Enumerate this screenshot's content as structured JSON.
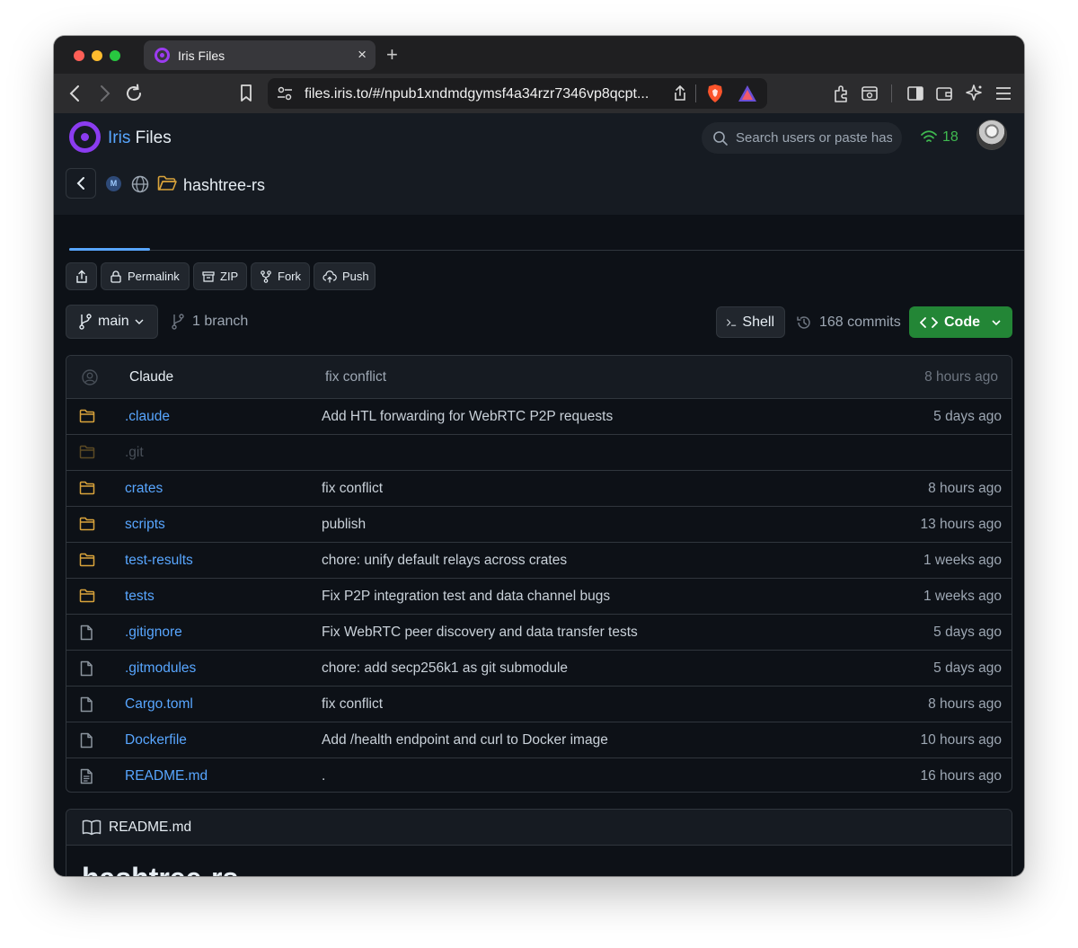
{
  "browser": {
    "tab_title": "Iris Files",
    "tab_close": "×",
    "new_tab": "+",
    "url": "files.iris.to/#/npub1xndmdgymsf4a34rzr7346vp8qcpt..."
  },
  "app": {
    "brand_primary": "Iris",
    "brand_secondary": "Files",
    "search_placeholder": "Search users or paste hash",
    "peer_count": "18",
    "repo_name": "hashtree-rs",
    "colors": {
      "accent": "#58a6ff",
      "brand": "#8b3cf0",
      "folder": "#d9a33b",
      "online": "#3fb950",
      "code_button": "#238636"
    }
  },
  "actions": [
    {
      "label": "",
      "icon": "share-icon"
    },
    {
      "label": "Permalink",
      "icon": "lock-icon"
    },
    {
      "label": "ZIP",
      "icon": "archive-icon"
    },
    {
      "label": "Fork",
      "icon": "fork-icon"
    },
    {
      "label": "Push",
      "icon": "cloud-upload-icon"
    }
  ],
  "repo_bar": {
    "branch": "main",
    "branch_count": "1 branch",
    "shell": "Shell",
    "commits": "168 commits",
    "code": "Code"
  },
  "last_commit": {
    "author": "Claude",
    "message": "fix conflict",
    "time": "8 hours ago"
  },
  "files": [
    {
      "type": "folder",
      "name": ".claude",
      "message": "Add HTL forwarding for WebRTC P2P requests",
      "time": "5 days ago",
      "dim": false
    },
    {
      "type": "folder",
      "name": ".git",
      "message": "",
      "time": "",
      "dim": true
    },
    {
      "type": "folder",
      "name": "crates",
      "message": "fix conflict",
      "time": "8 hours ago",
      "dim": false
    },
    {
      "type": "folder",
      "name": "scripts",
      "message": "publish",
      "time": "13 hours ago",
      "dim": false
    },
    {
      "type": "folder",
      "name": "test-results",
      "message": "chore: unify default relays across crates",
      "time": "1 weeks ago",
      "dim": false
    },
    {
      "type": "folder",
      "name": "tests",
      "message": "Fix P2P integration test and data channel bugs",
      "time": "1 weeks ago",
      "dim": false
    },
    {
      "type": "file",
      "name": ".gitignore",
      "message": "Fix WebRTC peer discovery and data transfer tests",
      "time": "5 days ago",
      "dim": false
    },
    {
      "type": "file",
      "name": ".gitmodules",
      "message": "chore: add secp256k1 as git submodule",
      "time": "5 days ago",
      "dim": false
    },
    {
      "type": "file",
      "name": "Cargo.toml",
      "message": "fix conflict",
      "time": "8 hours ago",
      "dim": false
    },
    {
      "type": "file",
      "name": "Dockerfile",
      "message": "Add /health endpoint and curl to Docker image",
      "time": "10 hours ago",
      "dim": false
    },
    {
      "type": "doc",
      "name": "README.md",
      "message": ".",
      "time": "16 hours ago",
      "dim": false
    }
  ],
  "readme": {
    "filename": "README.md",
    "heading": "hashtree-rs"
  }
}
